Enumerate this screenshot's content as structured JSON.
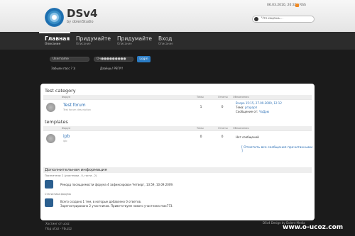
{
  "header": {
    "logo_text": "DSv4",
    "logo_sub": "by dolenStudio",
    "date": "06.03.2010, 20:32",
    "rss": "RSS",
    "search_placeholder": "Что ищешь..."
  },
  "nav": [
    {
      "label": "Главная",
      "sub": "Описание"
    },
    {
      "label": "Придумайте",
      "sub": "Описание"
    },
    {
      "label": "Придумайте",
      "sub": "Описание"
    },
    {
      "label": "Вход",
      "sub": "Описание"
    }
  ],
  "login": {
    "username_placeholder": "Username",
    "password_value": "Оч●●●●●●●●●",
    "button": "Login",
    "forgot": "Забыли пасс ? ))",
    "register": "Дааёшь! РЕГУ!!"
  },
  "forum": {
    "category1": "Test category",
    "category2": "templates",
    "col_forum": "Форум",
    "col_topics": "Темы",
    "col_replies": "Ответы",
    "col_updates": "Обновления",
    "rows": [
      {
        "name": "Test forum",
        "desc": "Test forum description",
        "topics": "1",
        "replies": "0",
        "last_date": "Вчера 15:15, 27.09.2009, 12:12",
        "last_topic_label": "Тема:",
        "last_topic": "ргарарп",
        "last_author_label": "Сообщение от:",
        "last_author": "ЧаДрю"
      },
      {
        "name": "ipb",
        "desc": "ipb",
        "topics": "0",
        "replies": "0",
        "last_date": "Нет сообщений"
      }
    ],
    "mark_read": "[ Отметить все сообщения прочитанными ]"
  },
  "info": {
    "title": "Дополнительная информация",
    "online_label": "Посетители: 2 (участники - 0, гости - 2)",
    "record": "Рекорд посещаемости форума 4 зафиксирован Четверг, 13:59, 10.09.2009.",
    "stats_label": "Статистика форума",
    "stats_line1": "Всего создано 1 тем, в которые добавлено 0 ответов.",
    "stats_line2": "Зарегистрировано 2 участников. Приветствуем нового участника max773."
  },
  "footer": {
    "hosted": "Хостинг от ucoz",
    "design": "Под uCoz - Fbuzzz",
    "right": "DSv4 Design by Dolent Media",
    "watermark": "www.o-ucoz.com"
  }
}
